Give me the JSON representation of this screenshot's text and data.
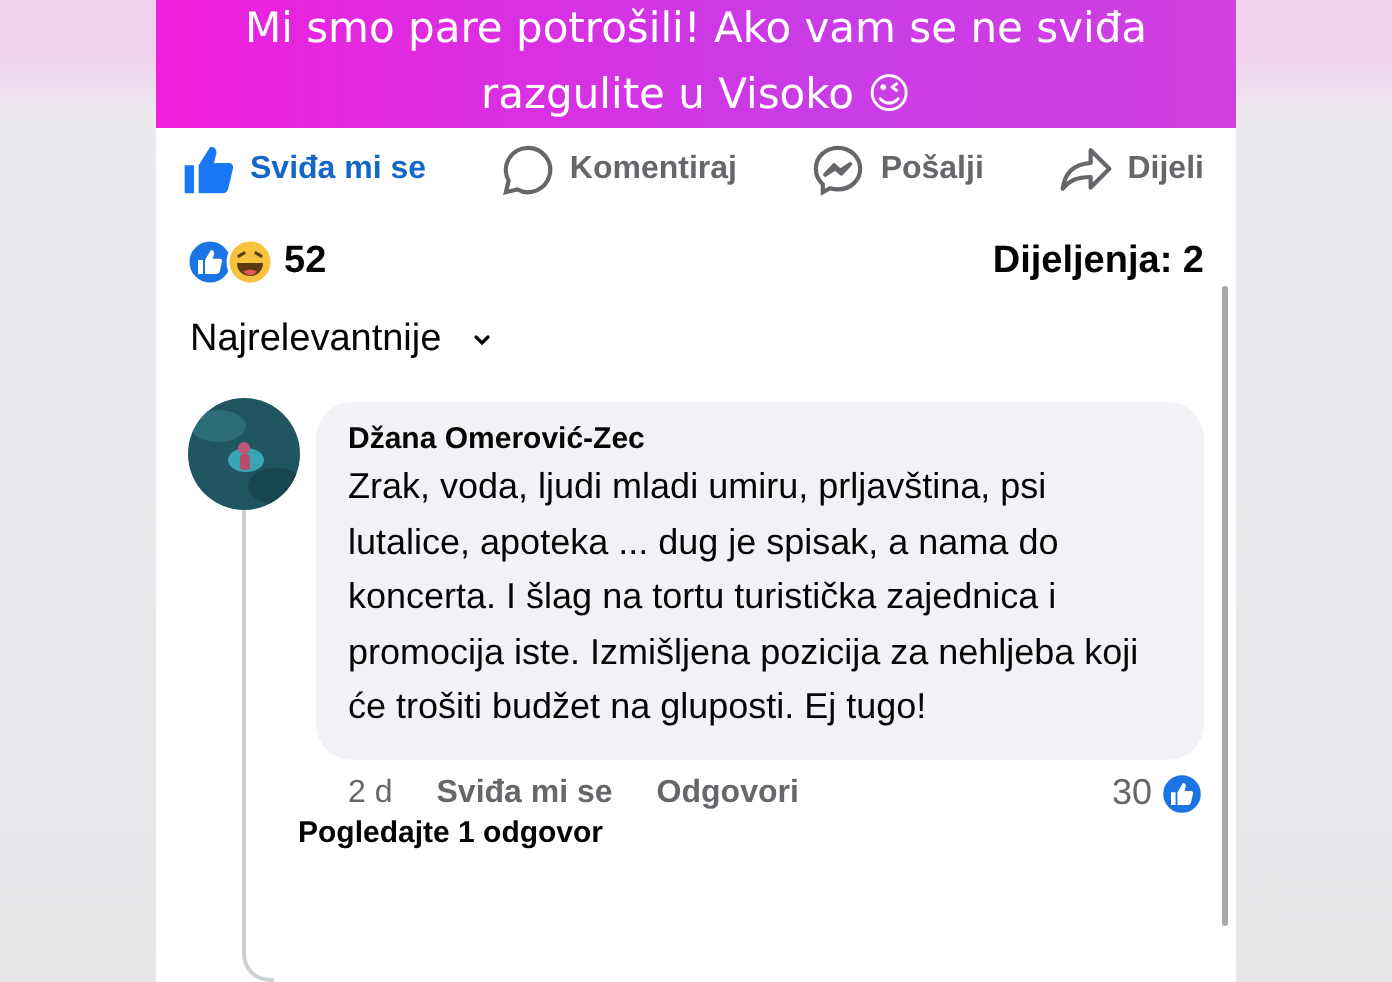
{
  "banner": {
    "lines": [
      "Mi smo pare potrošili! Ako vam se ne sviđa",
      "razgulite u Visoko 😉"
    ]
  },
  "actions": [
    {
      "kind": "like",
      "label": "Sviđa mi se",
      "selected": true
    },
    {
      "kind": "comment",
      "label": "Komentiraj",
      "selected": false
    },
    {
      "kind": "send",
      "label": "Pošalji",
      "selected": false
    },
    {
      "kind": "share",
      "label": "Dijeli",
      "selected": false
    }
  ],
  "reactions": {
    "count": "52",
    "shares": "Dijeljenja: 2"
  },
  "sort": {
    "label": "Najrelevantnije"
  },
  "comment": {
    "author": "Džana Omerović-Zec",
    "text": "Zrak, voda, ljudi mladi umiru, prljavština, psi lutalice, apoteka ... dug je spisak, a nama do koncerta. I šlag na tortu turistička zajednica i promocija iste. Izmišljena pozicija za nehljeba koji će trošiti budžet na gluposti. Ej tugo!",
    "time": "2 d",
    "like": "Sviđa mi se",
    "reply": "Odgovori",
    "likes": "30",
    "replies_link": "Pogledajte 1 odgovor"
  }
}
